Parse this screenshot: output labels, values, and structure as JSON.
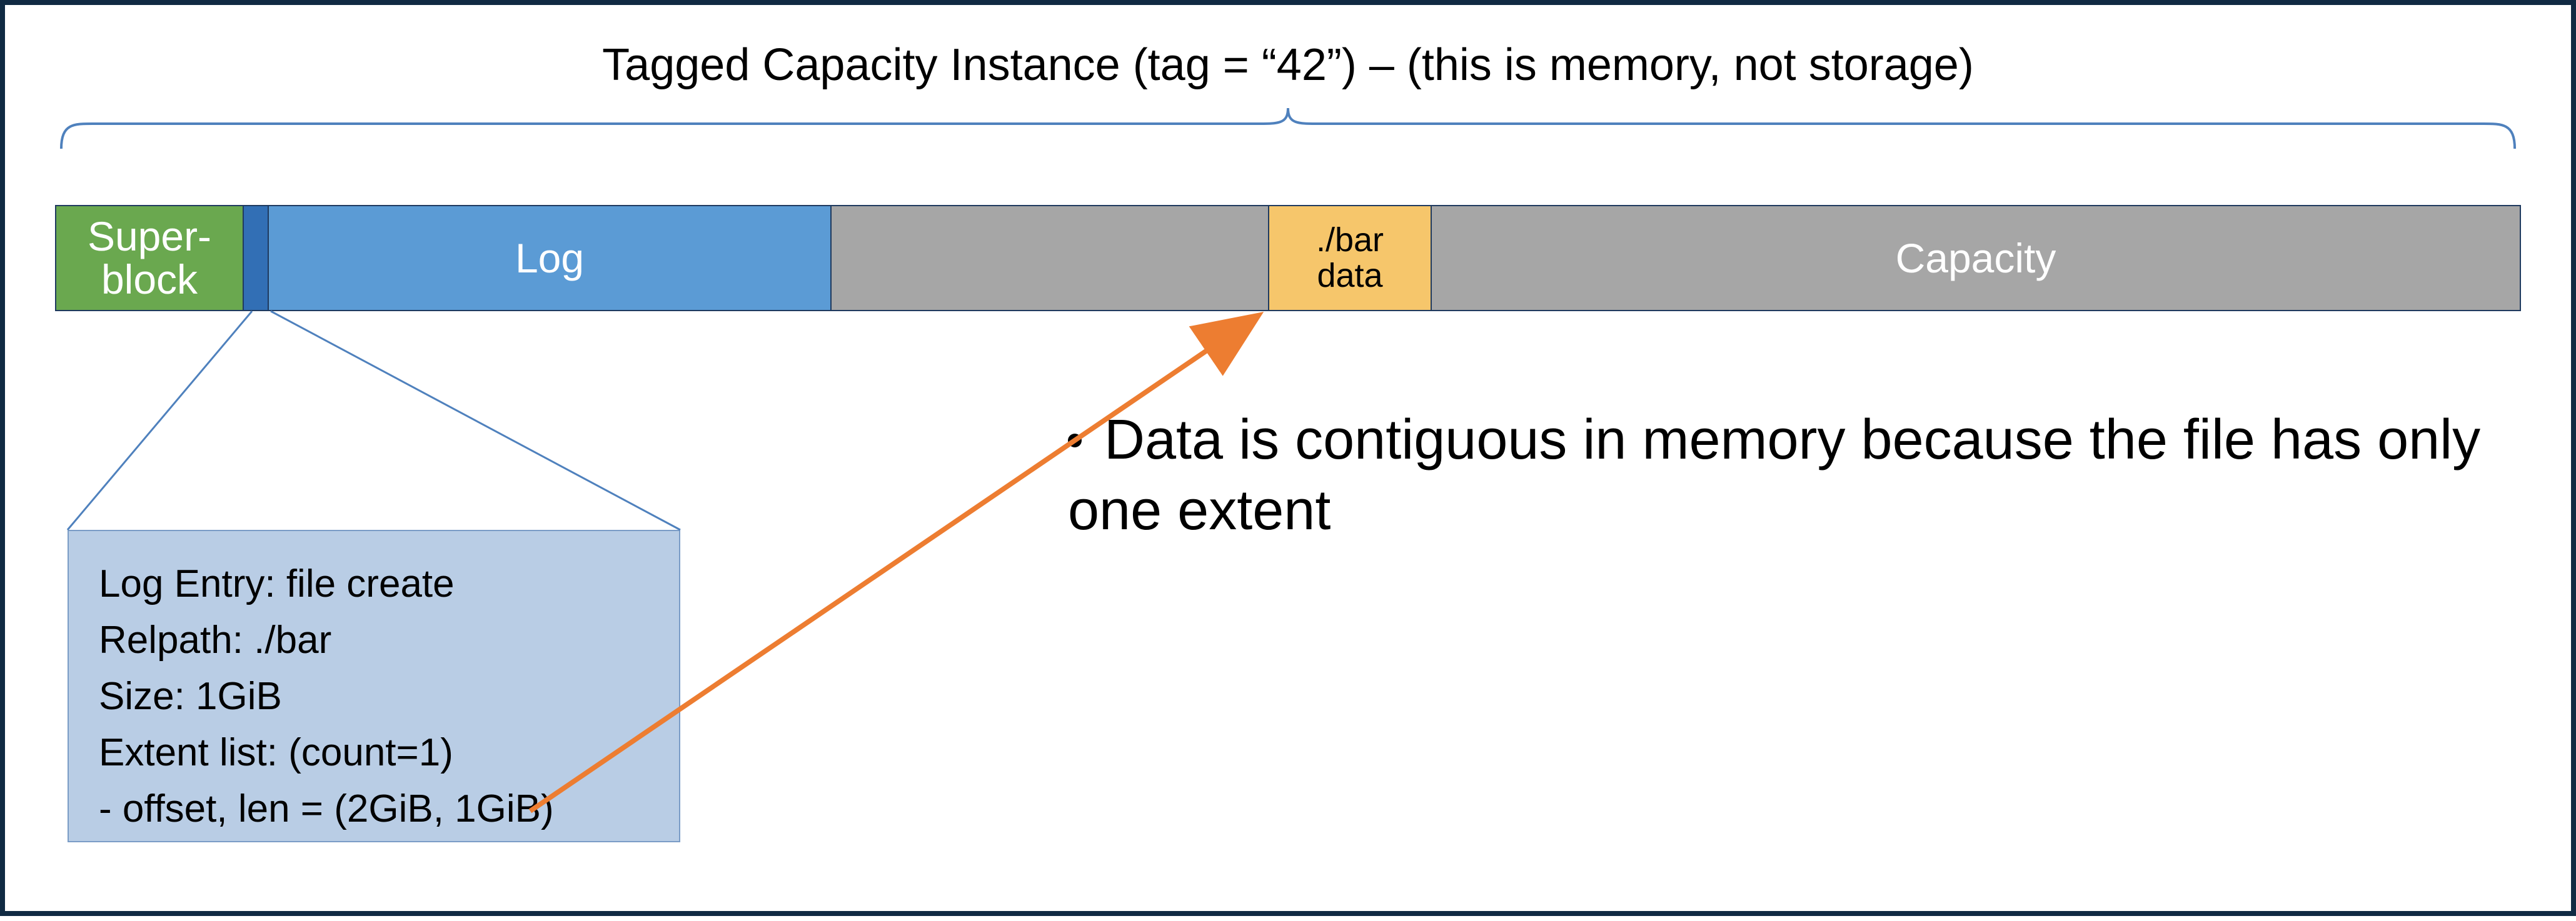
{
  "title": "Tagged Capacity Instance (tag = “42”) – (this is memory, not storage)",
  "segments": {
    "superblock": "Super-\nblock",
    "log": "Log",
    "bardata": "./bar\ndata",
    "capacity": "Capacity"
  },
  "callout": {
    "line1": "Log Entry: file create",
    "line2": "Relpath: ./bar",
    "line3": "Size: 1GiB",
    "line4": "Extent list: (count=1)",
    "line5": "- offset, len = (2GiB, 1GiB)"
  },
  "bullet": "Data is contiguous in memory because the file has only one extent"
}
